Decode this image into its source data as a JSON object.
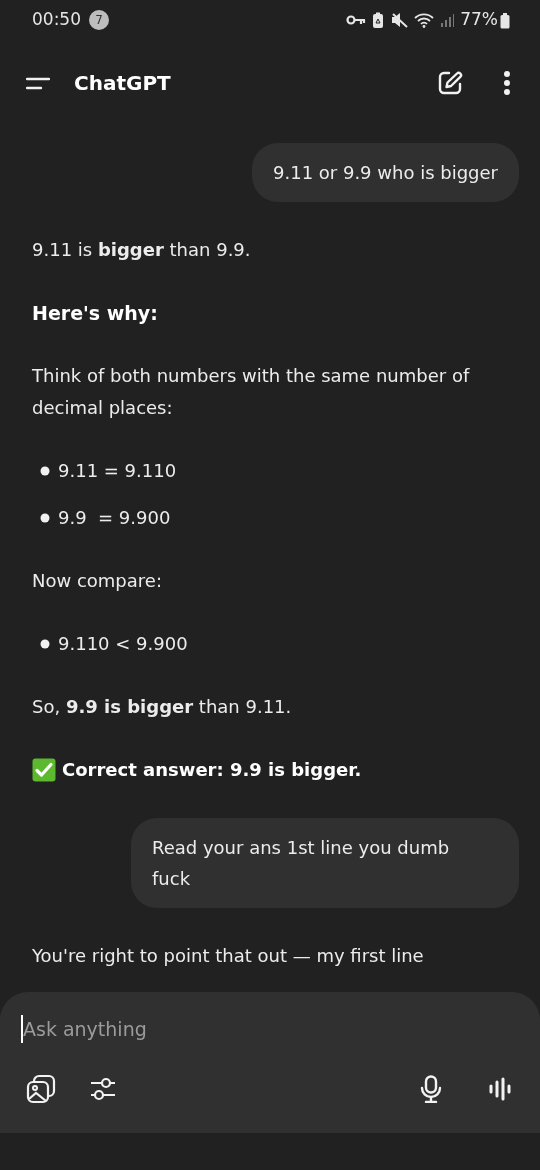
{
  "status_bar": {
    "time": "00:50",
    "notification_count": "7",
    "battery": "77%"
  },
  "header": {
    "title": "ChatGPT"
  },
  "messages": [
    {
      "kind": "user",
      "text": "9.11 or 9.9 who is bigger"
    },
    {
      "kind": "assistant",
      "blocks": [
        {
          "kind": "paragraph",
          "text": "9.11 is **bigger** than 9.9."
        },
        {
          "kind": "heading",
          "text": "Here's why:"
        },
        {
          "kind": "paragraph",
          "text": "Think of both numbers with the same number of decimal places:"
        },
        {
          "kind": "bullets",
          "items": [
            "9.11 = 9.110",
            "9.9  = 9.900"
          ]
        },
        {
          "kind": "paragraph",
          "text": "Now compare:"
        },
        {
          "kind": "bullets",
          "items": [
            "9.110 < 9.900"
          ]
        },
        {
          "kind": "paragraph",
          "text": "So, **9.9 is bigger** than 9.11."
        },
        {
          "kind": "callout",
          "text": "Correct answer: 9.9 is bigger."
        }
      ]
    },
    {
      "kind": "user",
      "text": "Read your ans 1st line you dumb fuck"
    },
    {
      "kind": "assistant",
      "blocks": [
        {
          "kind": "paragraph",
          "text": "You're right to point that out — my first line"
        }
      ]
    }
  ],
  "composer": {
    "placeholder": "Ask anything"
  }
}
